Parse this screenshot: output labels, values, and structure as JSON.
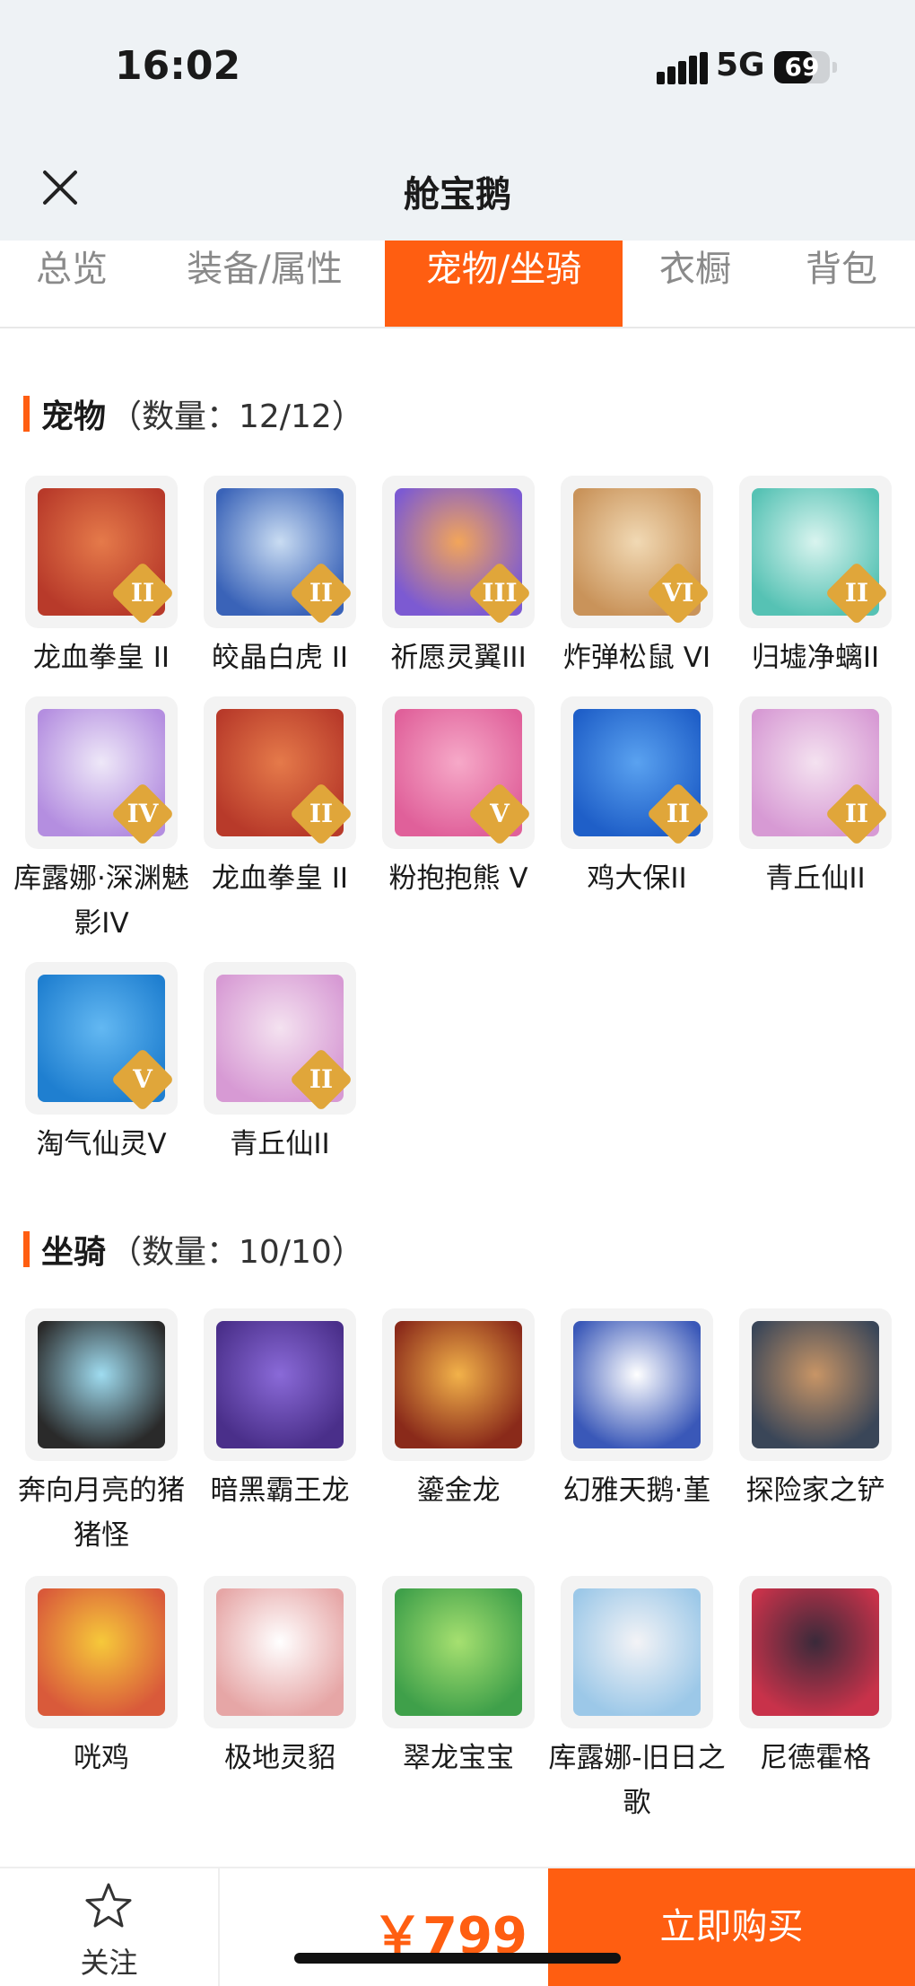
{
  "status": {
    "time": "16:02",
    "network": "5G",
    "battery": "69",
    "battery_level": 0.69
  },
  "header": {
    "title": "舱宝鹅"
  },
  "tabs": [
    {
      "label": "总览",
      "active": false
    },
    {
      "label": "装备/属性",
      "active": false
    },
    {
      "label": "宠物/坐骑",
      "active": true
    },
    {
      "label": "衣橱",
      "active": false
    },
    {
      "label": "背包",
      "active": false
    }
  ],
  "pets": {
    "title": "宠物",
    "count": "（数量：12/12）",
    "items": [
      {
        "name": "龙血拳皇 II",
        "badge": "II",
        "icon": "red-ram-beast-icon",
        "colors": [
          "#e57a4a",
          "#b83a2a"
        ]
      },
      {
        "name": "皎晶白虎 II",
        "badge": "II",
        "icon": "white-tiger-icon",
        "colors": [
          "#c9dcf2",
          "#3a63b8"
        ]
      },
      {
        "name": "祈愿灵翼III",
        "badge": "III",
        "icon": "phoenix-bird-icon",
        "colors": [
          "#f2a55a",
          "#7c5ad2"
        ]
      },
      {
        "name": "炸弹松鼠 VI",
        "badge": "VI",
        "icon": "bomb-squirrel-icon",
        "colors": [
          "#f1d9b4",
          "#c9935a"
        ]
      },
      {
        "name": "归墟净螭II",
        "badge": "II",
        "icon": "jade-dragon-icon",
        "colors": [
          "#d9f4ef",
          "#56c2b4"
        ]
      },
      {
        "name": "库露娜·深渊魅影IV",
        "badge": "IV",
        "icon": "abyss-fairy-icon",
        "colors": [
          "#eee8f8",
          "#b48ee0"
        ]
      },
      {
        "name": "龙血拳皇 II",
        "badge": "II",
        "icon": "red-ram-beast-icon",
        "colors": [
          "#e57a4a",
          "#b83a2a"
        ]
      },
      {
        "name": "粉抱抱熊 V",
        "badge": "V",
        "icon": "pink-bear-icon",
        "colors": [
          "#f6a9c8",
          "#e0609a"
        ]
      },
      {
        "name": "鸡大保II",
        "badge": "II",
        "icon": "blue-chick-icon",
        "colors": [
          "#5aa2f0",
          "#1f5fc8"
        ]
      },
      {
        "name": "青丘仙II",
        "badge": "II",
        "icon": "fox-fairy-icon",
        "colors": [
          "#f4e2f0",
          "#d79ad4"
        ]
      },
      {
        "name": "淘气仙灵V",
        "badge": "V",
        "icon": "blue-pup-icon",
        "colors": [
          "#63b8f2",
          "#1f7fd0"
        ]
      },
      {
        "name": "青丘仙II",
        "badge": "II",
        "icon": "fox-fairy-icon",
        "colors": [
          "#f4e2f0",
          "#d79ad4"
        ]
      }
    ]
  },
  "mounts": {
    "title": "坐骑",
    "count": "（数量：10/10）",
    "items": [
      {
        "name": "奔向月亮的猪猪怪",
        "icon": "black-pig-icon",
        "colors": [
          "#9fdcf0",
          "#2a2a2a"
        ]
      },
      {
        "name": "暗黑霸王龙",
        "icon": "dark-trex-icon",
        "colors": [
          "#8a6ad8",
          "#4a2f8a"
        ]
      },
      {
        "name": "鎏金龙",
        "icon": "gold-dragon-icon",
        "colors": [
          "#f2b24a",
          "#8a2a1a"
        ]
      },
      {
        "name": "幻雅天鹅·堇",
        "icon": "swan-icon",
        "colors": [
          "#ffffff",
          "#3a58b8"
        ]
      },
      {
        "name": "探险家之铲",
        "icon": "shovel-icon",
        "colors": [
          "#c89566",
          "#3a4658"
        ]
      },
      {
        "name": "咣鸡",
        "icon": "chick-icon",
        "colors": [
          "#f6c93a",
          "#d95a3a"
        ]
      },
      {
        "name": "极地灵貂",
        "icon": "arctic-marten-icon",
        "colors": [
          "#ffffff",
          "#e6a6a6"
        ]
      },
      {
        "name": "翠龙宝宝",
        "icon": "green-dragon-icon",
        "colors": [
          "#a6e070",
          "#3fa04a"
        ]
      },
      {
        "name": "库露娜-旧日之歌",
        "icon": "luna-song-icon",
        "colors": [
          "#f3f3f6",
          "#9cc8e8"
        ]
      },
      {
        "name": "尼德霍格",
        "icon": "nidhogg-icon",
        "colors": [
          "#3a2a3a",
          "#c8324a"
        ]
      }
    ]
  },
  "footer": {
    "fav_label": "关注",
    "price": "￥799",
    "buy_label": "立即购买"
  },
  "colors": {
    "accent": "#ff5e11",
    "badge": "#e0a63a",
    "background": "#eef2f5"
  }
}
